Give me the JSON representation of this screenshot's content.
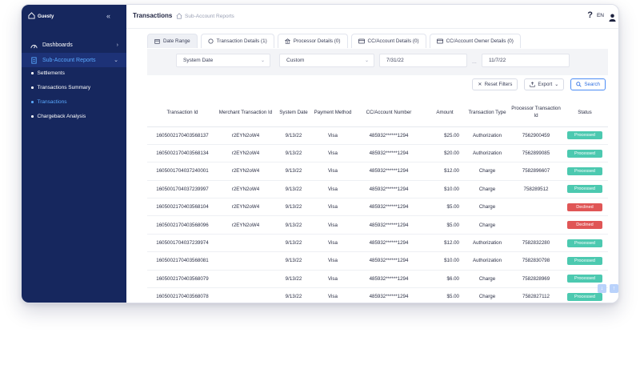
{
  "sidebar": {
    "brand": "Guesty",
    "collapse_icon": "double-chevron-left",
    "items": [
      {
        "label": "Dashboards",
        "icon": "dashboard-icon"
      },
      {
        "label": "Sub-Account Reports",
        "icon": "report-icon"
      }
    ],
    "sub_items": [
      {
        "label": "Settlements"
      },
      {
        "label": "Transactions Summary"
      },
      {
        "label": "Transactions"
      },
      {
        "label": "Chargeback Analysis"
      }
    ]
  },
  "header": {
    "title": "Transactions",
    "breadcrumb": "Sub-Account Reports",
    "help": "?",
    "lang": "EN"
  },
  "tabs": [
    {
      "label": "Date Range"
    },
    {
      "label": "Transaction Details (1)"
    },
    {
      "label": "Processor Details (0)"
    },
    {
      "label": "CC/Account Details (0)"
    },
    {
      "label": "CC/Account Owner Details (0)"
    }
  ],
  "filters": {
    "date_type": "System Date",
    "range": "Custom",
    "from": "7/31/22",
    "sep": "...",
    "to": "11/7/22"
  },
  "actions": {
    "reset": "Reset Filters",
    "export": "Export",
    "search": "Search"
  },
  "table": {
    "columns": [
      "Transaction Id",
      "Merchant Transaction Id",
      "System Date",
      "Payment Method",
      "CC/Account Number",
      "Amount",
      "Transaction Type",
      "Processor Transaction Id",
      "Status"
    ],
    "rows": [
      [
        "160500217040356813​7",
        "r2EYN2oW4",
        "9/13/22",
        "Visa",
        "485932******1294",
        "$25.00",
        "Authorization",
        "7562900459",
        "Processed"
      ],
      [
        "160500217040356813​4",
        "r2EYN2oW4",
        "9/13/22",
        "Visa",
        "485932******1294",
        "$20.00",
        "Authorization",
        "7562899085",
        "Processed"
      ],
      [
        "1605001704037240001",
        "r2EYN2oW4",
        "9/13/22",
        "Visa",
        "485932******1294",
        "$12.00",
        "Charge",
        "7582896607",
        "Processed"
      ],
      [
        "1605001704037239997",
        "r2EYN2oW4",
        "9/13/22",
        "Visa",
        "485932******1294",
        "$10.00",
        "Charge",
        "758289512",
        "Processed"
      ],
      [
        "1605002170403568104",
        "r2EYN2oW4",
        "9/13/22",
        "Visa",
        "485932******1294",
        "$5.00",
        "Charge",
        "",
        "Declined"
      ],
      [
        "1605002170403568096",
        "r2EYN2oW4",
        "9/13/22",
        "Visa",
        "485932******1294",
        "$5.00",
        "Charge",
        "",
        "Declined"
      ],
      [
        "1605001704037239974",
        "",
        "9/13/22",
        "Visa",
        "485932******1294",
        "$12.00",
        "Authorization",
        "7582832280",
        "Processed"
      ],
      [
        "1605002170403568081",
        "",
        "9/13/22",
        "Visa",
        "485932******1294",
        "$10.00",
        "Authorization",
        "7582830798",
        "Processed"
      ],
      [
        "1605002170403568079",
        "",
        "9/13/22",
        "Visa",
        "485932******1294",
        "$6.00",
        "Charge",
        "7582828969",
        "Processed"
      ],
      [
        "1605002170403568078",
        "",
        "9/13/22",
        "Visa",
        "485932******1294",
        "$5.00",
        "Charge",
        "75828271​12",
        "Processed"
      ]
    ]
  },
  "colors": {
    "sidebar": "#16275e",
    "processed": "#4cc9b0",
    "declined": "#e05656",
    "accent": "#2f6fe0"
  }
}
